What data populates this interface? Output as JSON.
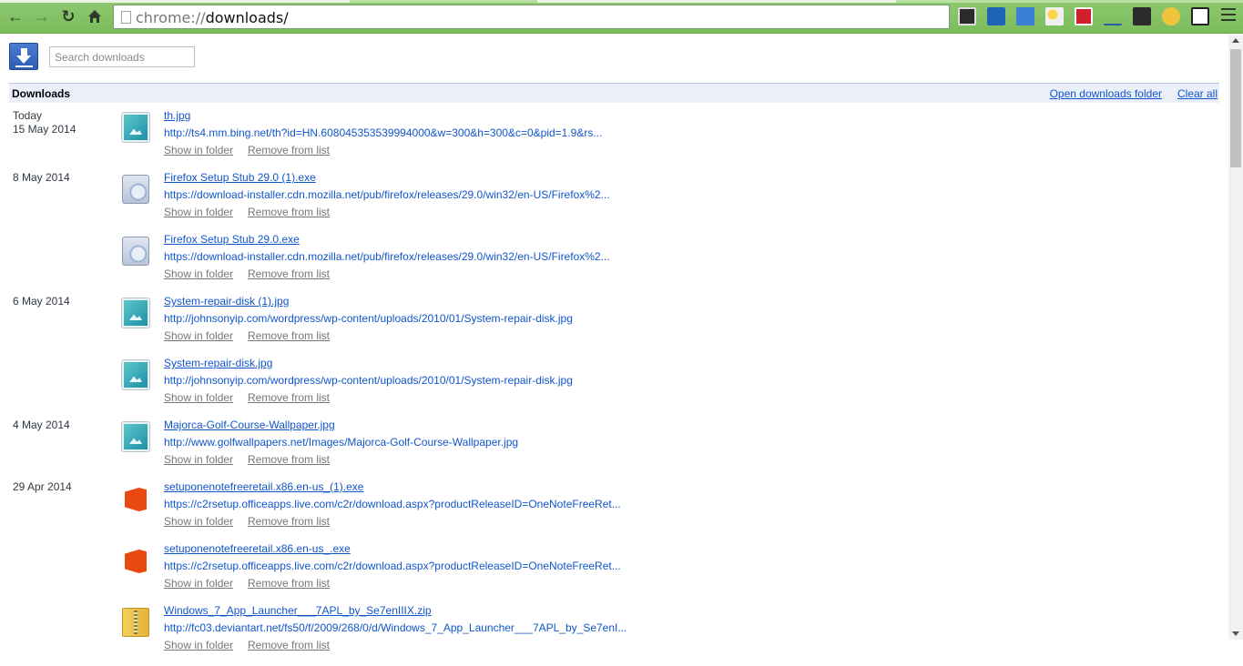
{
  "browser": {
    "url_scheme": "chrome://",
    "url_path": "downloads/",
    "extension_icons": [
      "film-icon",
      "hs-icon",
      "folder-icon",
      "weather-icon",
      "blocked-icon",
      "pen-icon",
      "terminal-icon",
      "fox-icon",
      "s-icon"
    ]
  },
  "search": {
    "placeholder": "Search downloads"
  },
  "header": {
    "title": "Downloads",
    "open_folder": "Open downloads folder",
    "clear_all": "Clear all"
  },
  "actions": {
    "show": "Show in folder",
    "remove": "Remove from list"
  },
  "downloads": [
    {
      "date": "Today",
      "date2": "15 May 2014",
      "icon": "image-file-icon",
      "name": "th.jpg",
      "url": "http://ts4.mm.bing.net/th?id=HN.608045353539994000&w=300&h=300&c=0&pid=1.9&rs..."
    },
    {
      "date": "8 May 2014",
      "date2": "",
      "icon": "installer-icon",
      "name": "Firefox Setup Stub 29.0 (1).exe",
      "url": "https://download-installer.cdn.mozilla.net/pub/firefox/releases/29.0/win32/en-US/Firefox%2..."
    },
    {
      "date": "",
      "date2": "",
      "icon": "installer-icon",
      "name": "Firefox Setup Stub 29.0.exe",
      "url": "https://download-installer.cdn.mozilla.net/pub/firefox/releases/29.0/win32/en-US/Firefox%2..."
    },
    {
      "date": "6 May 2014",
      "date2": "",
      "icon": "image-file-icon",
      "name": "System-repair-disk (1).jpg",
      "url": "http://johnsonyip.com/wordpress/wp-content/uploads/2010/01/System-repair-disk.jpg"
    },
    {
      "date": "",
      "date2": "",
      "icon": "image-file-icon",
      "name": "System-repair-disk.jpg",
      "url": "http://johnsonyip.com/wordpress/wp-content/uploads/2010/01/System-repair-disk.jpg"
    },
    {
      "date": "4 May 2014",
      "date2": "",
      "icon": "image-file-icon",
      "name": "Majorca-Golf-Course-Wallpaper.jpg",
      "url": "http://www.golfwallpapers.net/Images/Majorca-Golf-Course-Wallpaper.jpg"
    },
    {
      "date": "29 Apr 2014",
      "date2": "",
      "icon": "office-icon",
      "name": "setuponenotefreeretail.x86.en-us_(1).exe",
      "url": "https://c2rsetup.officeapps.live.com/c2r/download.aspx?productReleaseID=OneNoteFreeRet..."
    },
    {
      "date": "",
      "date2": "",
      "icon": "office-icon",
      "name": "setuponenotefreeretail.x86.en-us_.exe",
      "url": "https://c2rsetup.officeapps.live.com/c2r/download.aspx?productReleaseID=OneNoteFreeRet..."
    },
    {
      "date": "",
      "date2": "",
      "icon": "zip-icon",
      "name": "Windows_7_App_Launcher___7APL_by_Se7enIIIX.zip",
      "url": "http://fc03.deviantart.net/fs50/f/2009/268/0/d/Windows_7_App_Launcher___7APL_by_Se7enI..."
    }
  ]
}
